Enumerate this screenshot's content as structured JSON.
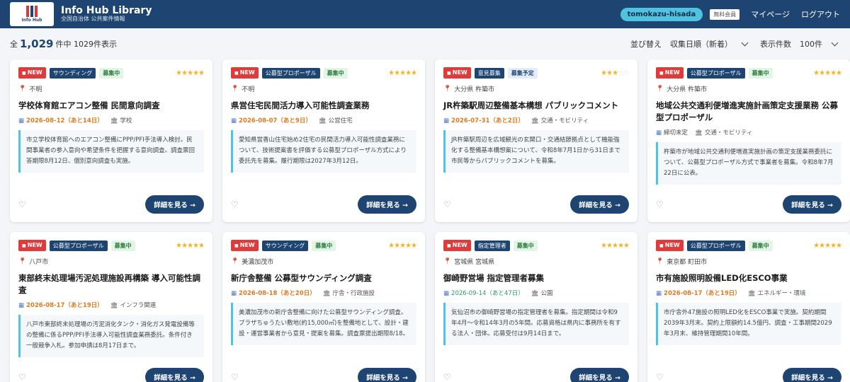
{
  "header": {
    "logo_text": "Info Hub",
    "title": "Info Hub Library",
    "subtitle": "全国自治体 公共案件情報",
    "username": "tomokazu-hisada",
    "member_badge": "無料会員",
    "nav_mypage": "マイページ",
    "nav_logout": "ログアウト"
  },
  "toolbar": {
    "prefix": "全",
    "count": "1,029",
    "suffix": "件中 1029件表示",
    "sort_label": "並び替え",
    "sort_value": "収集日順（新着）",
    "per_page_label": "表示件数",
    "per_page_value": "100件"
  },
  "cards": [
    {
      "new": "NEW",
      "type": "サウンディング",
      "status": "募集中",
      "stars": 5,
      "location": "不明",
      "title": "学校体育館エアコン整備 民間意向調査",
      "date": "2026-08-12（あと14日）",
      "category": "学校",
      "desc": "市立学校体育館へのエアコン整備にPPP/PFI手法導入検討。民間事業者の参入意向や希望条件を把握する意向調査。調査票回答期限8月12日、個別意向調査も実施。",
      "detail": "詳細を見る →"
    },
    {
      "new": "NEW",
      "type": "公募型プロポーザル",
      "status": "募集中",
      "stars": 5,
      "location": "不明",
      "title": "県営住宅民間活力導入可能性調査業務",
      "date": "2026-08-07（あと9日）",
      "category": "公営住宅",
      "desc": "愛知県営香山住宅始め2住宅の民間活力導入可能性調査業務について、技術提案書を評価する公募型プロポーザル方式により委託先を募集。履行期限は2027年3月12日。",
      "detail": "詳細を見る →"
    },
    {
      "new": "NEW",
      "type": "意見募集",
      "status": "募集予定",
      "stars": 3,
      "location": "大分県 杵築市",
      "title": "JR杵築駅周辺整備基本構想 パブリックコメント",
      "date": "2026-07-31（あと2日）",
      "category": "交通・モビリティ",
      "desc": "JR杵築駅周辺を広域観光の玄関口・交通結節拠点として機能強化する整備基本構想案について、令和8年7月1日から31日まで市民等からパブリックコメントを募集。",
      "detail": "詳細を見る →"
    },
    {
      "new": "NEW",
      "type": "公募型プロポーザル",
      "status": "募集中",
      "stars": 5,
      "location": "大分県 杵築市",
      "title": "地域公共交通利便増進実施計画策定支援業務 公募型プロポーザル",
      "date": "締切未定",
      "category": "交通・モビリティ",
      "desc": "杵築市が地域公共交通利便増進実施計画の策定支援業務委託について、公募型プロポーザル方式で事業者を募集。令和8年7月22日に公表。",
      "detail": "詳細を見る →"
    },
    {
      "new": "NEW",
      "type": "公募型プロポーザル",
      "status": "募集中",
      "stars": 5,
      "location": "八戸市",
      "title": "東部終末処理場汚泥処理施設再構築 導入可能性調査",
      "date": "2026-08-17（あと19日）",
      "category": "インフラ関連",
      "desc": "八戸市東部終末処理場の汚泥消化タンク・消化ガス発電設備等の整備に係るPPP/PFI手法導入可能性調査業務委託。条件付き一般競争入札。参加申請は8月17日まで。",
      "detail": "詳細を見る →"
    },
    {
      "new": "NEW",
      "type": "サウンディング",
      "status": "募集中",
      "stars": 5,
      "location": "美濃加茂市",
      "title": "新庁舎整備 公募型サウンディング調査",
      "date": "2026-08-18（あと20日）",
      "category": "庁舎・行政施設",
      "desc": "美濃加茂市の新庁舎整備に向けた公募型サウンディング調査。プラザちゅうたい敷地(約15,000㎡)を整備地として、設計・建設・運営事業者から意見・提案を募集。調査票提出期限8/18。",
      "detail": "詳細を見る →"
    },
    {
      "new": "NEW",
      "type": "指定管理者",
      "status": "募集中",
      "stars": 5,
      "location": "宮城県 宮城県",
      "title": "御崎野営場 指定管理者募集",
      "date": "2026-09-14（あと47日）",
      "category": "公園",
      "desc": "気仙沼市の御崎野営場の指定管理者を募集。指定期間は令和9年4月～令和14年3月の5年間。応募資格は県内に事務所を有する法人・団体。応募受付は9月14日まで。",
      "detail": "詳細を見る →"
    },
    {
      "new": "NEW",
      "type": "公募型プロポーザル",
      "status": "募集中",
      "stars": 5,
      "location": "東京都 町田市",
      "title": "市有施設照明設備LED化ESCO事業",
      "date": "2026-08-17（あと19日）",
      "category": "エネルギー・環境",
      "desc": "市庁舎外47施設の照明LED化をESCO事業で実施。契約期間2039年3月末。契約上限額約14.5億円、調査・工事期間2029年3月末、維持管理期間10年間。",
      "detail": "詳細を見る →"
    }
  ]
}
